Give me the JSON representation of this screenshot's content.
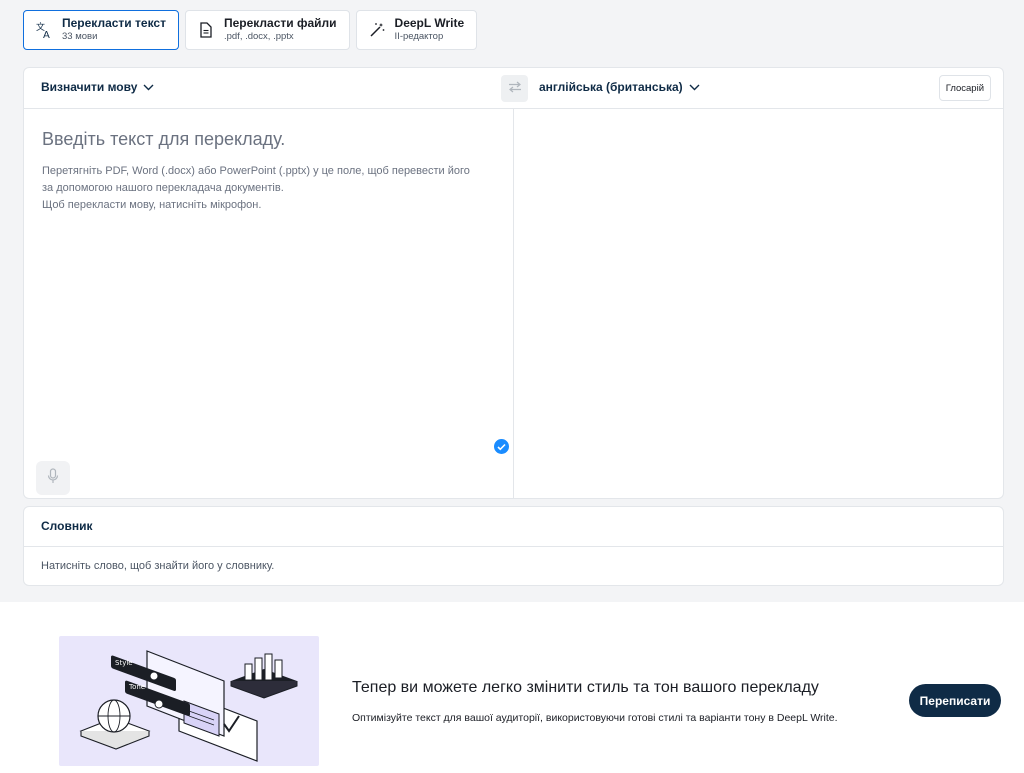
{
  "tabs": [
    {
      "title": "Перекласти текст",
      "subtitle": "33 мови",
      "icon": "translate-icon",
      "active": true
    },
    {
      "title": "Перекласти файли",
      "subtitle": ".pdf, .docx, .pptx",
      "icon": "document-icon",
      "active": false
    },
    {
      "title": "DeepL Write",
      "subtitle": "ІІ-редактор",
      "icon": "magic-wand-icon",
      "active": false
    }
  ],
  "translator": {
    "source_lang": "Визначити мову",
    "target_lang": "англійська (британська)",
    "glossary_label": "Глосарій",
    "placeholder_title": "Введіть текст для перекладу.",
    "placeholder_line1": "Перетягніть PDF, Word (.docx) або PowerPoint (.pptx) у це поле, щоб перевести його за допомогою нашого перекладача документів.",
    "placeholder_line2": "Щоб перекласти мову, натисніть мікрофон."
  },
  "dictionary": {
    "title": "Словник",
    "hint": "Натисніть слово, щоб знайти його у словнику."
  },
  "promo": {
    "title": "Тепер ви можете легко змінити стиль та тон вашого перекладу",
    "description": "Оптимізуйте текст для вашої аудиторії, використовуючи готові стилі та варіанти тону в DeepL Write.",
    "button": "Переписати",
    "illustration_labels": [
      "Style",
      "Tone"
    ]
  },
  "colors": {
    "accent": "#0f6fde",
    "navy": "#0f2b46",
    "check_blue": "#1a8cff",
    "promo_bg": "#e9e6fb"
  }
}
